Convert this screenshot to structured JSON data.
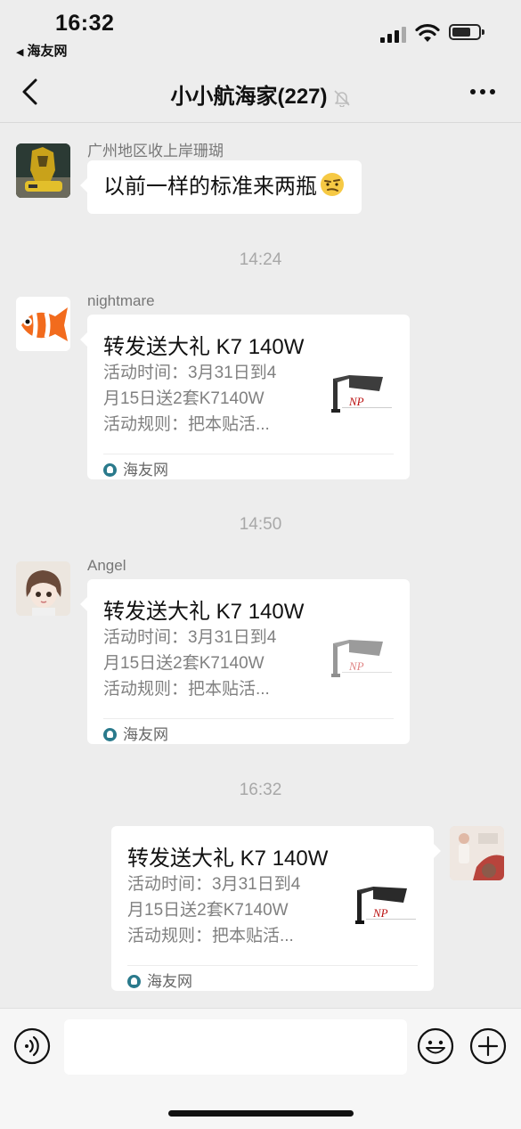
{
  "status_bar": {
    "time": "16:32",
    "back_app": "海友网"
  },
  "nav": {
    "title": "小小航海家(227)"
  },
  "messages": [
    {
      "sender": "广州地区收上岸珊瑚",
      "text": "以前一样的标准来两瓶"
    },
    {
      "timestamp": "14:24"
    },
    {
      "sender": "nightmare",
      "card": {
        "title": "转发送大礼 K7 140W",
        "desc_lines": [
          "活动时间：3月31日到4",
          "月15日送2套K7140W",
          "活动规则：把本贴活..."
        ],
        "source": "海友网"
      }
    },
    {
      "timestamp": "14:50"
    },
    {
      "sender": "Angel",
      "card": {
        "title": "转发送大礼 K7 140W",
        "desc_lines": [
          "活动时间：3月31日到4",
          "月15日送2套K7140W",
          "活动规则：把本贴活..."
        ],
        "source": "海友网"
      }
    },
    {
      "timestamp": "16:32"
    },
    {
      "sender": "",
      "card": {
        "title": "转发送大礼 K7 140W",
        "desc_lines": [
          "活动时间：3月31日到4",
          "月15日送2套K7140W",
          "活动规则：把本贴活..."
        ],
        "source": "海友网"
      }
    }
  ],
  "colors": {
    "background": "#ededed",
    "bubble": "#ffffff",
    "accent_brand": "#2a7a8c"
  }
}
